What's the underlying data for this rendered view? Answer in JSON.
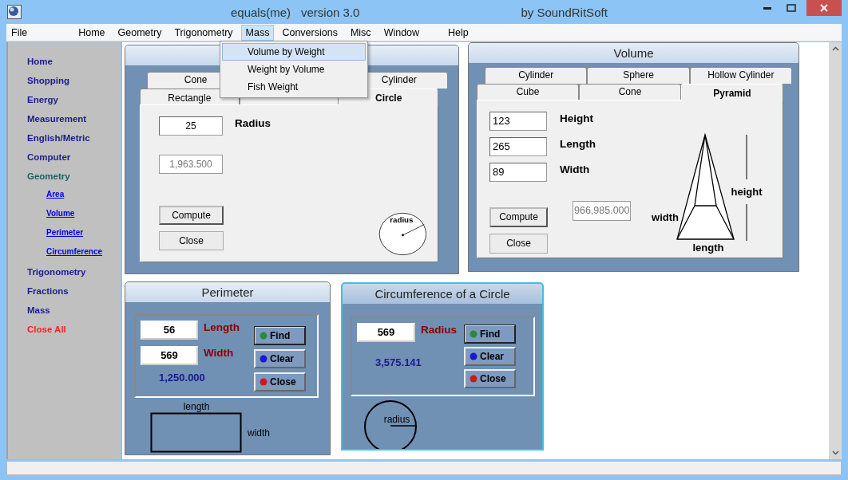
{
  "window": {
    "title": "equals(me)",
    "version": "version 3.0",
    "publisher": "by SoundRitSoft"
  },
  "menu_bar": [
    {
      "label": "File",
      "selected": false
    },
    {
      "label": "Home",
      "selected": false
    },
    {
      "label": "Geometry",
      "selected": false
    },
    {
      "label": "Trigonometry",
      "selected": false
    },
    {
      "label": "Mass",
      "selected": true
    },
    {
      "label": "Conversions",
      "selected": false
    },
    {
      "label": "Misc",
      "selected": false
    },
    {
      "label": "Window",
      "selected": false
    },
    {
      "label": "Help",
      "selected": false
    }
  ],
  "open_menu": {
    "items": [
      {
        "label": "Volume by Weight",
        "selected": true
      },
      {
        "label": "Weight by Volume",
        "selected": false
      },
      {
        "label": "Fish Weight",
        "selected": false
      }
    ]
  },
  "sidebar": {
    "items": [
      {
        "label": "Home",
        "kind": "section",
        "selected": false
      },
      {
        "label": "Shopping",
        "kind": "section",
        "selected": false
      },
      {
        "label": "Energy",
        "kind": "section",
        "selected": false
      },
      {
        "label": "Measurement",
        "kind": "section",
        "selected": false
      },
      {
        "label": "English/Metric",
        "kind": "section",
        "selected": false
      },
      {
        "label": "Computer",
        "kind": "section",
        "selected": false
      },
      {
        "label": "Geometry",
        "kind": "section",
        "selected": true,
        "children": [
          {
            "label": "Area"
          },
          {
            "label": "Volume"
          },
          {
            "label": "Perimeter"
          },
          {
            "label": "Circumference"
          }
        ]
      },
      {
        "label": "Trigonometry",
        "kind": "section",
        "selected": false
      },
      {
        "label": "Fractions",
        "kind": "section",
        "selected": false
      },
      {
        "label": "Mass",
        "kind": "section",
        "selected": false
      },
      {
        "label": "Close All",
        "kind": "command",
        "selected": false
      }
    ]
  },
  "area_window": {
    "active": false,
    "tabs_back": [
      {
        "label": "Cone",
        "selected": false
      },
      {
        "label": "Cylinder",
        "selected": false
      }
    ],
    "tabs_front": [
      {
        "label": "Rectangle",
        "selected": false
      },
      {
        "selected": false
      },
      {
        "label": "Circle",
        "selected": true
      }
    ],
    "fields": [
      {
        "label": "Radius",
        "value": "25"
      }
    ],
    "result": "1,963.500",
    "buttons": [
      "Compute",
      "Close"
    ],
    "diagram_labels": [
      "radius"
    ]
  },
  "volume_window": {
    "title": "Volume",
    "active": false,
    "tabs_back": [
      {
        "label": "Cylinder",
        "selected": false
      },
      {
        "label": "Sphere",
        "selected": false
      },
      {
        "label": "Hollow Cylinder",
        "selected": false
      }
    ],
    "tabs_front": [
      {
        "label": "Cube",
        "selected": false
      },
      {
        "label": "Cone",
        "selected": false
      },
      {
        "label": "Pyramid",
        "selected": true
      }
    ],
    "fields": [
      {
        "label": "Height",
        "value": "123"
      },
      {
        "label": "Length",
        "value": "265"
      },
      {
        "label": "Width",
        "value": "89"
      }
    ],
    "result": "966,985.000",
    "buttons": [
      "Compute",
      "Close"
    ],
    "diagram_labels": [
      "height",
      "width",
      "length"
    ]
  },
  "perimeter_window": {
    "title": "Perimeter",
    "active": false,
    "fields": [
      {
        "label": "Length",
        "value": "56"
      },
      {
        "label": "Width",
        "value": "569"
      }
    ],
    "result": "1,250.000",
    "buttons": [
      {
        "label": "Find",
        "color": "#2a8a3a",
        "focused": true
      },
      {
        "label": "Clear",
        "color": "#1a1ad0",
        "focused": false
      },
      {
        "label": "Close",
        "color": "#d01a1a",
        "focused": false
      }
    ],
    "diagram_labels": [
      "length",
      "width"
    ]
  },
  "circumference_window": {
    "title": "Circumference of a Circle",
    "active": true,
    "fields": [
      {
        "label": "Radius",
        "value": "569"
      }
    ],
    "result": "3,575.141",
    "buttons": [
      {
        "label": "Find",
        "color": "#2a8a3a",
        "focused": true
      },
      {
        "label": "Clear",
        "color": "#1a1ad0",
        "focused": false
      },
      {
        "label": "Close",
        "color": "#d01a1a",
        "focused": false
      }
    ],
    "diagram_labels": [
      "radius"
    ]
  }
}
